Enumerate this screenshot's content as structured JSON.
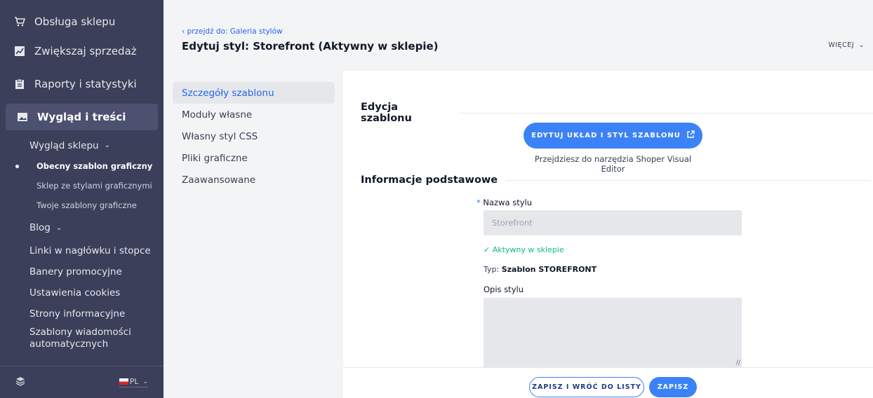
{
  "sidebar": {
    "main_items": [
      {
        "label": "Obsługa sklepu",
        "icon": "cart-icon"
      },
      {
        "label": "Zwiększaj sprzedaż",
        "icon": "chart-icon"
      },
      {
        "label": "Raporty i statystyki",
        "icon": "report-icon"
      },
      {
        "label": "Wygląd i treści",
        "icon": "image-icon"
      }
    ],
    "appearance_group": "Wygląd sklepu",
    "appearance_items": [
      "Obecny szablon graficzny",
      "Sklep ze stylami graficznymi",
      "Twoje szablony graficzne"
    ],
    "blog": "Blog",
    "links": [
      "Linki w nagłówku i stopce",
      "Banery promocyjne",
      "Ustawienia cookies",
      "Strony informacyjne"
    ],
    "auto_messages": "Szablony wiadomości automatycznych",
    "language": "PL"
  },
  "header": {
    "back_link": "przejdź do: Galeria stylów",
    "title": "Edytuj styl: Storefront (Aktywny w sklepie)",
    "more": "WIĘCEJ"
  },
  "subnav": {
    "items": [
      "Szczegóły szablonu",
      "Moduły własne",
      "Własny styl CSS",
      "Pliki graficzne",
      "Zaawansowane"
    ]
  },
  "content": {
    "edit_section": "Edycja szablonu",
    "edit_button": "EDYTUJ UKŁAD I STYL SZABLONU",
    "edit_hint": "Przejdziesz do narzędzia Shoper Visual Editor",
    "basic_section": "Informacje podstawowe",
    "name_label": "Nazwa stylu",
    "name_value": "Storefront",
    "active_status": "Aktywny w sklepie",
    "type_prefix": "Typ:",
    "type_value": "Szablon STOREFRONT",
    "description_label": "Opis stylu"
  },
  "footer": {
    "save_return": "ZAPISZ I WRÓĆ DO LISTY",
    "save": "ZAPISZ"
  },
  "colors": {
    "accent": "#3b82f6",
    "sidebar": "#3b3f5a",
    "success": "#10b981"
  }
}
